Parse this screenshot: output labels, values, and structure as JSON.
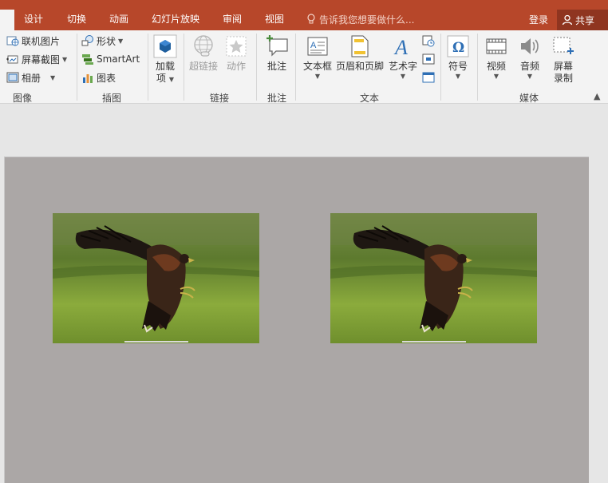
{
  "tabs": [
    {
      "label": "设计"
    },
    {
      "label": "切换"
    },
    {
      "label": "动画"
    },
    {
      "label": "幻灯片放映"
    },
    {
      "label": "审阅"
    },
    {
      "label": "视图"
    }
  ],
  "tell_me": {
    "placeholder": "告诉我您想要做什么..."
  },
  "account": {
    "login_label": "登录",
    "share_label": "共享"
  },
  "ribbon": {
    "images_group": {
      "label": "图像",
      "online_pictures": "联机图片",
      "screenshot": "屏幕截图",
      "photo_album": "相册"
    },
    "illustrations_group": {
      "label": "插图",
      "shapes": "形状",
      "smartart": "SmartArt",
      "chart": "图表"
    },
    "addins_group": {
      "label_line1": "加载",
      "label_line2": "项"
    },
    "links_group": {
      "label": "链接",
      "hyperlink": "超链接",
      "action": "动作"
    },
    "comments_group": {
      "label": "批注",
      "comment": "批注"
    },
    "text_group": {
      "label": "文本",
      "textbox": "文本框",
      "header_footer": "页眉和页脚",
      "wordart": "艺术字"
    },
    "symbols_group": {
      "symbol": "符号"
    },
    "media_group": {
      "label": "媒体",
      "video": "视频",
      "audio": "音频",
      "screen_recording_line1": "屏幕",
      "screen_recording_line2": "录制"
    }
  },
  "colors": {
    "accent": "#b7472a",
    "share_bg": "#8f3520",
    "slide_bg": "#aba7a6"
  }
}
